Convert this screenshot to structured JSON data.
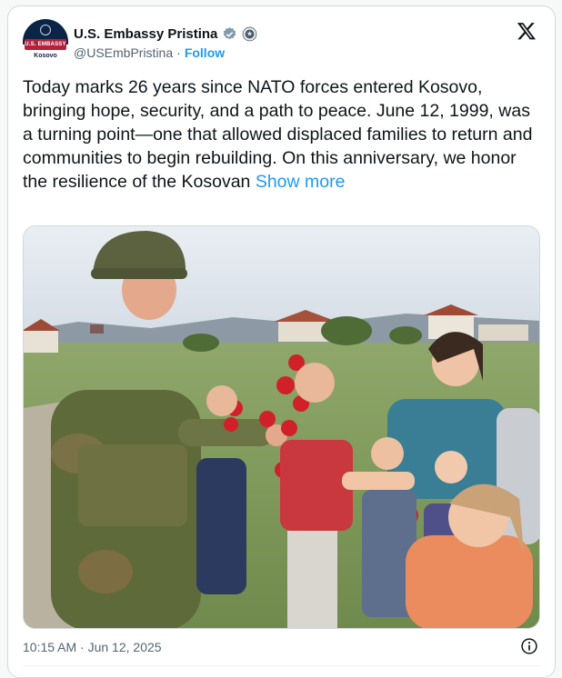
{
  "account": {
    "display_name": "U.S. Embassy Pristina",
    "handle": "@USEmbPristina",
    "separator": "·",
    "follow_label": "Follow",
    "avatar_band_text": "U.S. EMBASSY",
    "avatar_sub_text": "Kosovo"
  },
  "tweet": {
    "text": "Today marks 26 years since NATO forces entered Kosovo, bringing hope, security, and a path to peace. June 12, 1999, was a turning point—one that allowed displaced families to return and communities to begin rebuilding. On this anniversary, we honor the resilience of the Kosovan ",
    "show_more_label": "Show more",
    "timestamp": "10:15 AM · Jun 12, 2025"
  },
  "colors": {
    "accent": "#1d9bf0",
    "text_primary": "#0f1419",
    "text_secondary": "#536471",
    "verified_badge": "#829aab",
    "border": "#cfd9de"
  },
  "icons": {
    "verified": "verified-badge-icon",
    "government": "government-seal-icon",
    "x_logo": "x-logo-icon",
    "info": "info-icon"
  }
}
